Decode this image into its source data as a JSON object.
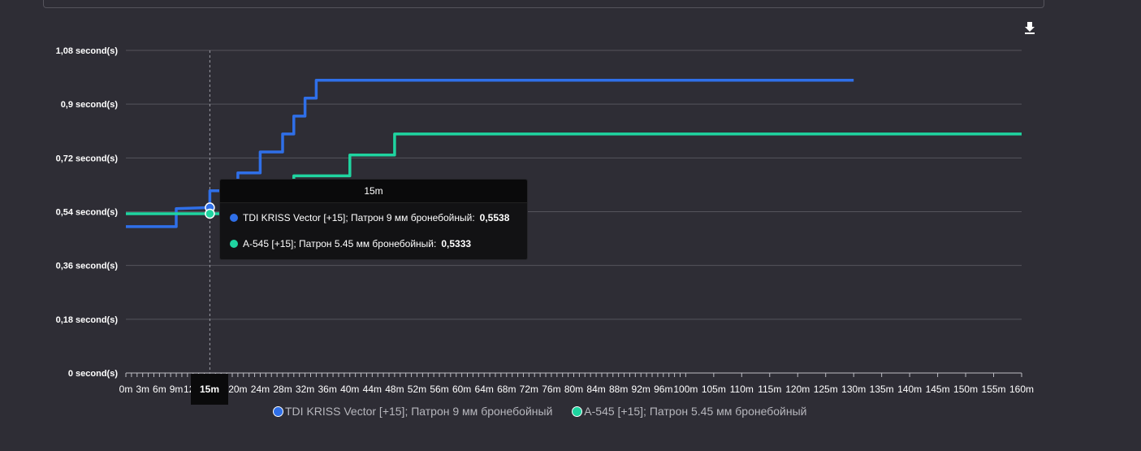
{
  "chart_data": {
    "type": "line",
    "y_axis": {
      "ticks": [
        "0 second(s)",
        "0,18 second(s)",
        "0,36 second(s)",
        "0,54 second(s)",
        "0,72 second(s)",
        "0,9 second(s)",
        "1,08 second(s)"
      ],
      "tick_values": [
        0,
        0.18,
        0.36,
        0.54,
        0.72,
        0.9,
        1.08
      ],
      "ylim": [
        0,
        1.08
      ]
    },
    "x_axis": {
      "xlim": [
        0,
        160
      ],
      "ticks": [
        {
          "value": 0,
          "label": "0m"
        },
        {
          "value": 3,
          "label": "3m"
        },
        {
          "value": 6,
          "label": "6m"
        },
        {
          "value": 9,
          "label": "9m"
        },
        {
          "value": 12,
          "label": "12m"
        },
        {
          "value": 15,
          "label": "15m"
        },
        {
          "value": 20,
          "label": "20m"
        },
        {
          "value": 24,
          "label": "24m"
        },
        {
          "value": 28,
          "label": "28m"
        },
        {
          "value": 32,
          "label": "32m"
        },
        {
          "value": 36,
          "label": "36m"
        },
        {
          "value": 40,
          "label": "40m"
        },
        {
          "value": 44,
          "label": "44m"
        },
        {
          "value": 48,
          "label": "48m"
        },
        {
          "value": 52,
          "label": "52m"
        },
        {
          "value": 56,
          "label": "56m"
        },
        {
          "value": 60,
          "label": "60m"
        },
        {
          "value": 64,
          "label": "64m"
        },
        {
          "value": 68,
          "label": "68m"
        },
        {
          "value": 72,
          "label": "72m"
        },
        {
          "value": 76,
          "label": "76m"
        },
        {
          "value": 80,
          "label": "80m"
        },
        {
          "value": 84,
          "label": "84m"
        },
        {
          "value": 88,
          "label": "88m"
        },
        {
          "value": 92,
          "label": "92m"
        },
        {
          "value": 96,
          "label": "96m"
        },
        {
          "value": 100,
          "label": "100m"
        },
        {
          "value": 105,
          "label": "105m"
        },
        {
          "value": 110,
          "label": "110m"
        },
        {
          "value": 115,
          "label": "115m"
        },
        {
          "value": 120,
          "label": "120m"
        },
        {
          "value": 125,
          "label": "125m"
        },
        {
          "value": 130,
          "label": "130m"
        },
        {
          "value": 135,
          "label": "135m"
        },
        {
          "value": 140,
          "label": "140m"
        },
        {
          "value": 145,
          "label": "145m"
        },
        {
          "value": 150,
          "label": "150m"
        },
        {
          "value": 155,
          "label": "155m"
        },
        {
          "value": 160,
          "label": "160m"
        }
      ]
    },
    "series": [
      {
        "name": "TDI KRISS Vector [+15]; Патрон 9 мм бронебойный",
        "color": "#2f6fe8",
        "points": [
          [
            0,
            0.49
          ],
          [
            9,
            0.49
          ],
          [
            9,
            0.55
          ],
          [
            15,
            0.5538
          ],
          [
            15,
            0.61
          ],
          [
            20,
            0.61
          ],
          [
            20,
            0.67
          ],
          [
            24,
            0.67
          ],
          [
            24,
            0.74
          ],
          [
            28,
            0.74
          ],
          [
            28,
            0.8
          ],
          [
            30,
            0.8
          ],
          [
            30,
            0.86
          ],
          [
            32,
            0.86
          ],
          [
            32,
            0.92
          ],
          [
            34,
            0.92
          ],
          [
            34,
            0.98
          ],
          [
            130,
            0.98
          ]
        ]
      },
      {
        "name": "A-545 [+15]; Патрон 5.45 мм бронебойный",
        "color": "#1fd4a0",
        "points": [
          [
            0,
            0.5333
          ],
          [
            24,
            0.5333
          ],
          [
            24,
            0.59
          ],
          [
            30,
            0.59
          ],
          [
            30,
            0.66
          ],
          [
            40,
            0.66
          ],
          [
            40,
            0.73
          ],
          [
            48,
            0.73
          ],
          [
            48,
            0.8
          ],
          [
            160,
            0.8
          ]
        ]
      }
    ],
    "tooltip": {
      "title": "15m",
      "items": [
        {
          "label": "TDI KRISS Vector [+15]; Патрон 9 мм бронебойный:",
          "value": "0,5538",
          "color": "#2f6fe8"
        },
        {
          "label": "A-545 [+15]; Патрон 5.45 мм бронебойный:",
          "value": "0,5333",
          "color": "#1fd4a0"
        }
      ]
    },
    "crosshair": {
      "x": 15,
      "label": "15m"
    },
    "legend": [
      {
        "name": "TDI KRISS Vector [+15]; Патрон 9 мм бронебойный",
        "color": "#2f6fe8"
      },
      {
        "name": "A-545 [+15]; Патрон 5.45 мм бронебойный",
        "color": "#1fd4a0"
      }
    ],
    "legend_position": "bottom-center",
    "grid": true
  },
  "icons": {
    "download": "download-icon"
  }
}
